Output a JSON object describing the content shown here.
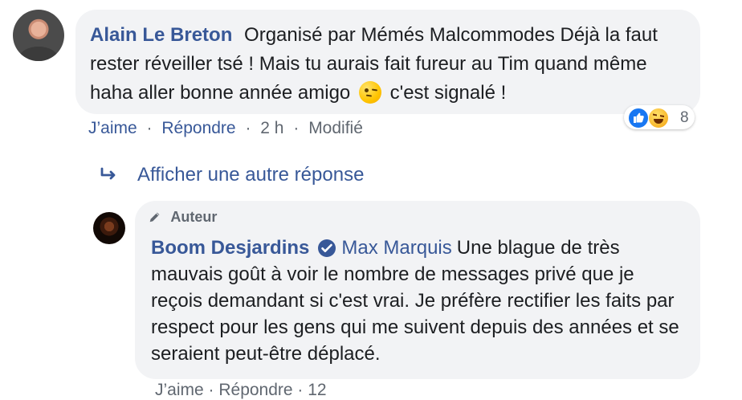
{
  "main_comment": {
    "author": "Alain Le Breton",
    "text_before_emoji": "Organisé par Mémés Malcommodes Déjà la faut rester réveiller tsé ! Mais tu aurais fait fureur au Tim quand même haha aller bonne année amigo",
    "text_after_emoji": "c'est signalé !",
    "reaction_count": "8",
    "actions": {
      "like": "J’aime",
      "reply": "Répondre",
      "time": "2 h",
      "edited": "Modifié"
    }
  },
  "replies_link": {
    "label": "Afficher une autre réponse"
  },
  "reply_comment": {
    "badge": "Auteur",
    "author": "Boom Desjardins",
    "mention": "Max Marquis",
    "text": "Une blague de très mauvais goût à voir le nombre de messages privé que je reçois demandant si c'est vrai. Je préfère rectifier les faits par respect pour les gens qui me suivent depuis des années et se seraient peut-être déplacé.",
    "partial_actions": "J’aime · Répondre · 12"
  },
  "colors": {
    "link": "#385898",
    "bubble": "#f2f3f5",
    "meta": "#606770",
    "like": "#1877f2"
  }
}
